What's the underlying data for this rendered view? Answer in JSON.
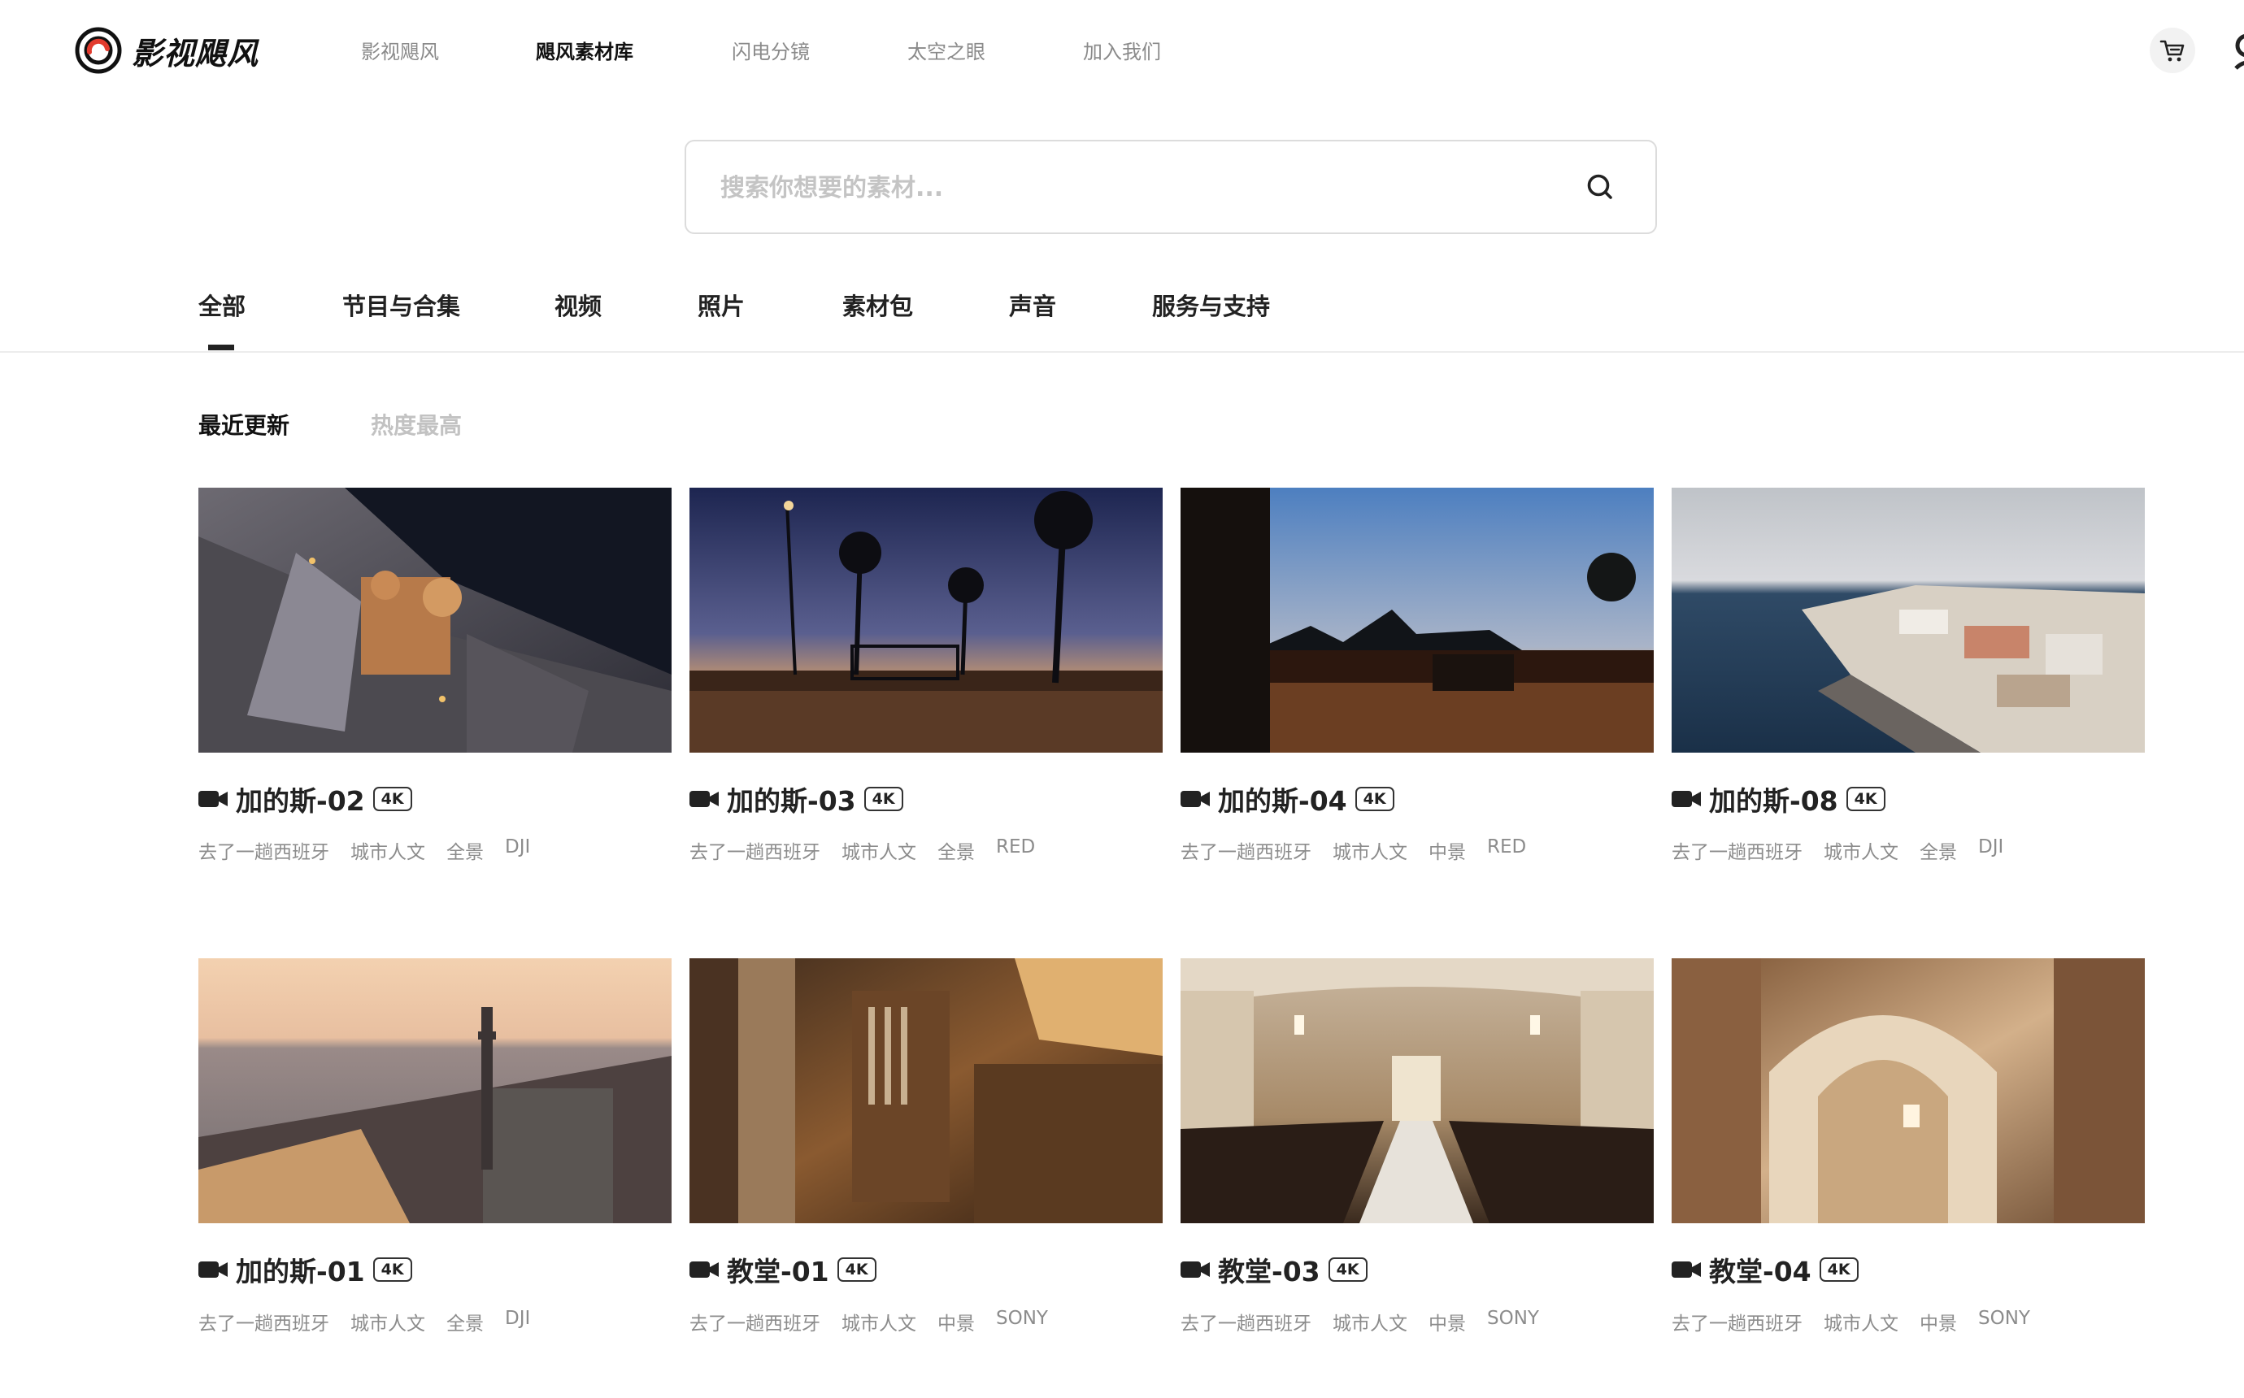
{
  "header": {
    "logo_text": "影视飓风",
    "nav": [
      "影视飓风",
      "飓风素材库",
      "闪电分镜",
      "太空之眼",
      "加入我们"
    ],
    "active_nav": "飓风素材库",
    "icons": {
      "cart": "cart-icon"
    }
  },
  "search": {
    "placeholder": "搜索你想要的素材...",
    "icon": "search-icon"
  },
  "categories": [
    "全部",
    "节目与合集",
    "视频",
    "照片",
    "素材包",
    "声音",
    "服务与支持"
  ],
  "active_category": "全部",
  "sort": [
    "最近更新",
    "热度最高"
  ],
  "active_sort": "最近更新",
  "cards": [
    {
      "title": "加的斯-02",
      "badge": "4K",
      "tags": [
        "去了一趟西班牙",
        "城市人文",
        "全景",
        "DJI"
      ]
    },
    {
      "title": "加的斯-03",
      "badge": "4K",
      "tags": [
        "去了一趟西班牙",
        "城市人文",
        "全景",
        "RED"
      ]
    },
    {
      "title": "加的斯-04",
      "badge": "4K",
      "tags": [
        "去了一趟西班牙",
        "城市人文",
        "中景",
        "RED"
      ]
    },
    {
      "title": "加的斯-08",
      "badge": "4K",
      "tags": [
        "去了一趟西班牙",
        "城市人文",
        "全景",
        "DJI"
      ]
    },
    {
      "title": "加的斯-01",
      "badge": "4K",
      "tags": [
        "去了一趟西班牙",
        "城市人文",
        "全景",
        "DJI"
      ]
    },
    {
      "title": "教堂-01",
      "badge": "4K",
      "tags": [
        "去了一趟西班牙",
        "城市人文",
        "中景",
        "SONY"
      ]
    },
    {
      "title": "教堂-03",
      "badge": "4K",
      "tags": [
        "去了一趟西班牙",
        "城市人文",
        "中景",
        "SONY"
      ]
    },
    {
      "title": "教堂-04",
      "badge": "4K",
      "tags": [
        "去了一趟西班牙",
        "城市人文",
        "中景",
        "SONY"
      ]
    }
  ]
}
